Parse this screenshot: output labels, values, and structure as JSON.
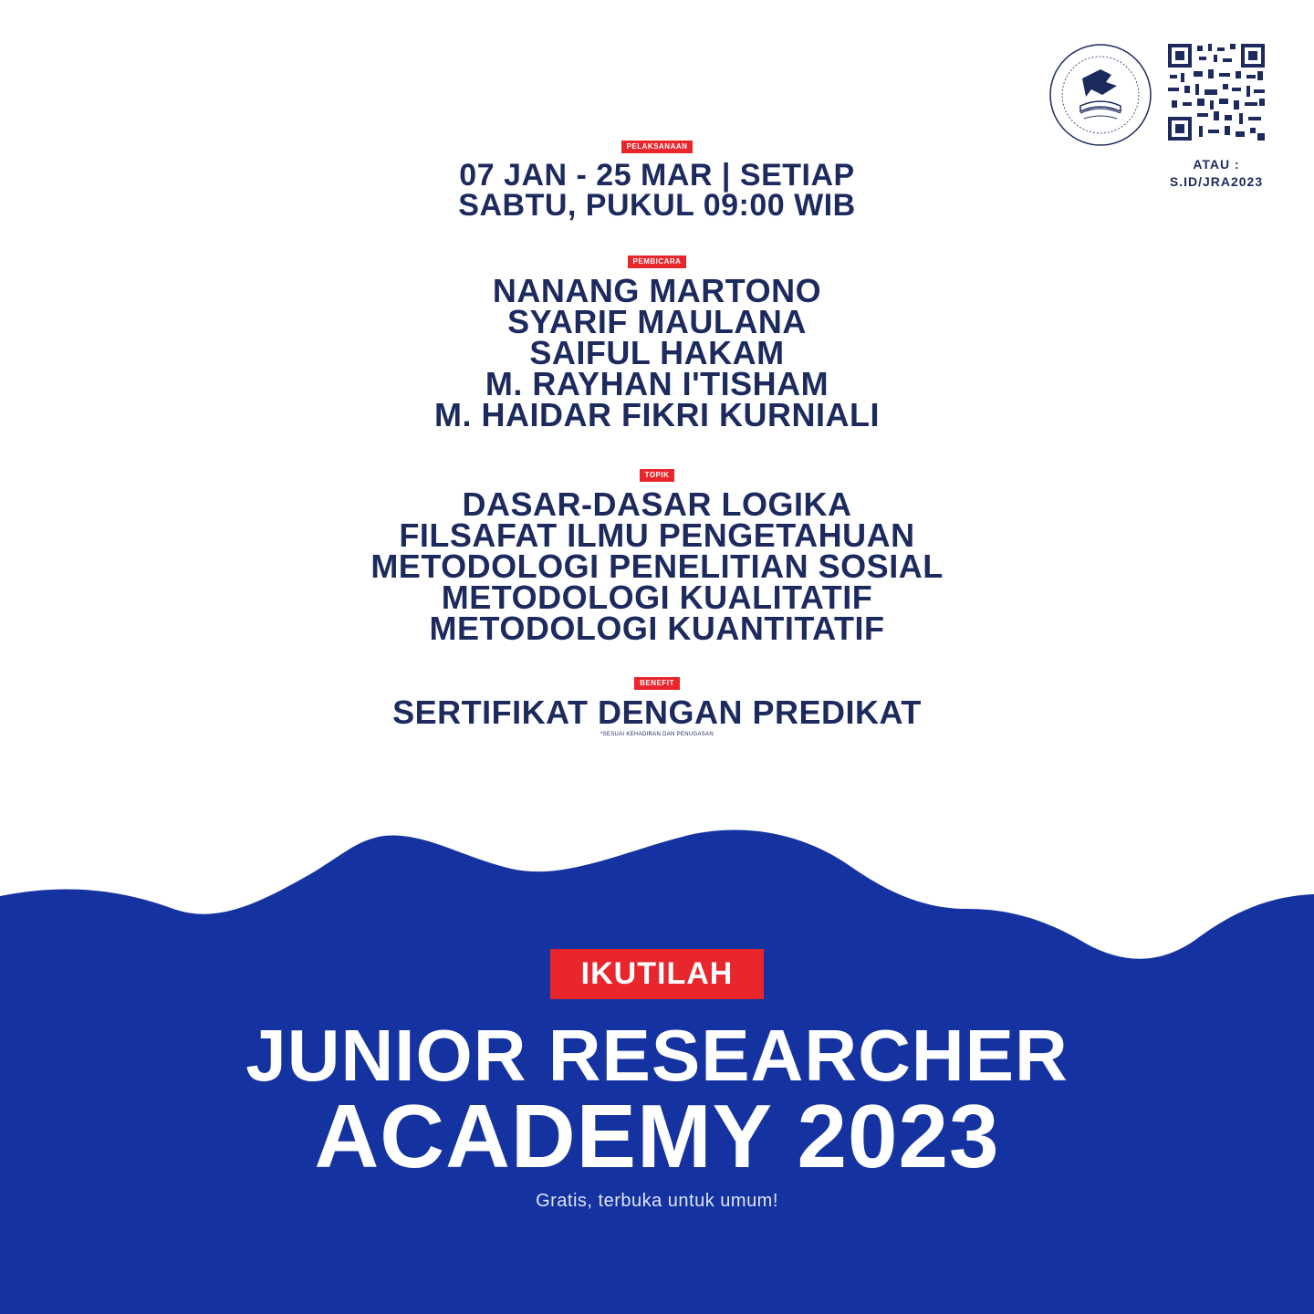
{
  "header": {
    "qr_caption_line1": "ATAU :",
    "qr_caption_line2": "S.ID/JRA2023"
  },
  "schedule": {
    "tag": "PELAKSANAAN",
    "lines": [
      "07 JAN - 25 MAR | SETIAP",
      "SABTU, PUKUL 09:00 WIB"
    ]
  },
  "speakers": {
    "tag": "PEMBICARA",
    "names": [
      "NANANG MARTONO",
      "SYARIF MAULANA",
      "SAIFUL HAKAM",
      "M. RAYHAN I'TISHAM",
      "M. HAIDAR FIKRI KURNIALI"
    ]
  },
  "topics": {
    "tag": "TOPIK",
    "items": [
      "DASAR-DASAR LOGIKA",
      "FILSAFAT ILMU PENGETAHUAN",
      "METODOLOGI PENELITIAN SOSIAL",
      "METODOLOGI KUALITATIF",
      "METODOLOGI KUANTITATIF"
    ]
  },
  "benefit": {
    "tag": "BENEFIT",
    "text": "SERTIFIKAT DENGAN PREDIKAT",
    "note": "*SESUAI KEHADIRAN DAN PENUGASAN"
  },
  "promo": {
    "cta": "IKUTILAH",
    "title_line1": "JUNIOR RESEARCHER",
    "title_line2": "ACADEMY 2023",
    "subtitle": "Gratis, terbuka untuk umum!"
  },
  "colors": {
    "navy": "#1c2a5e",
    "red": "#e8262c",
    "blue": "#1533a0",
    "white": "#ffffff"
  },
  "icons": {
    "logo": "eagle-emblem-icon",
    "qr": "qr-code-icon"
  }
}
